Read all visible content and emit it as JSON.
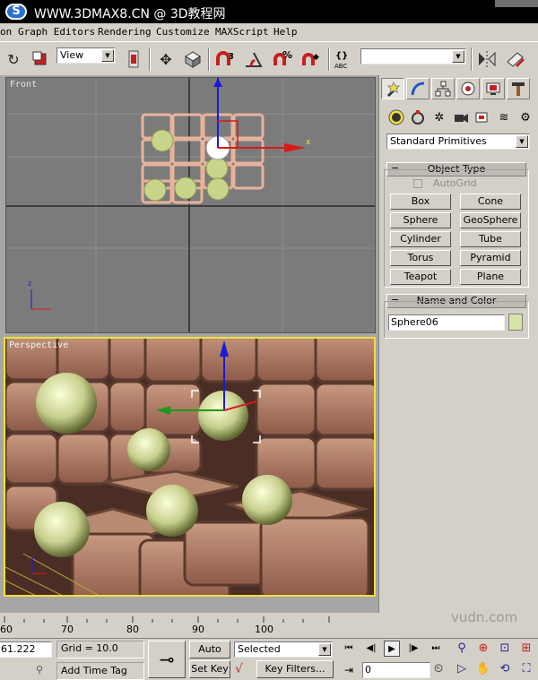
{
  "titlebar": {
    "icon_glyph": "S",
    "text": "WWW.3DMAX8.CN @ 3D教程网"
  },
  "menu": {
    "items": [
      "on",
      "Graph Editors",
      "Rendering",
      "Customize",
      "MAXScript",
      "Help"
    ]
  },
  "toolbar": {
    "view_select": "View",
    "named_selection": "",
    "icons": [
      "undo-icon",
      "select-icon",
      "move-icon",
      "rotate-icon",
      "magnet-icon",
      "angle-snap-icon",
      "percent-snap-icon",
      "spinner-snap-icon",
      "edit-named-icon",
      "mirror-icon",
      "align-icon"
    ]
  },
  "viewports": {
    "front_label": "Front",
    "persp_label": "Perspective",
    "axis_x": "x",
    "axis_z": "z"
  },
  "command_panel": {
    "tabs": [
      "create-icon",
      "modify-icon",
      "hierarchy-icon",
      "motion-icon",
      "display-icon",
      "utilities-icon"
    ],
    "subcategories": [
      "geometry-icon",
      "shapes-icon",
      "lights-icon",
      "cameras-icon",
      "helpers-icon",
      "spacewarps-icon",
      "systems-icon"
    ],
    "category_select": "Standard Primitives",
    "object_type": {
      "header": "Object Type",
      "autogrid": "AutoGrid",
      "buttons": [
        "Box",
        "Cone",
        "Sphere",
        "GeoSphere",
        "Cylinder",
        "Tube",
        "Torus",
        "Pyramid",
        "Teapot",
        "Plane"
      ]
    },
    "name_color": {
      "header": "Name and Color",
      "name_value": "Sphere06",
      "color": "#d8e3a6"
    }
  },
  "timeline": {
    "ticks": [
      "60",
      "70",
      "80",
      "90",
      "100"
    ]
  },
  "status": {
    "coord_value": "61.222",
    "grid": "Grid = 10.0",
    "add_time_tag": "Add Time Tag",
    "auto_key": "Auto Key",
    "set_key": "Set Key",
    "selected": "Selected",
    "key_filters": "Key Filters...",
    "frame_value": "0"
  },
  "watermark": "vudn.com"
}
